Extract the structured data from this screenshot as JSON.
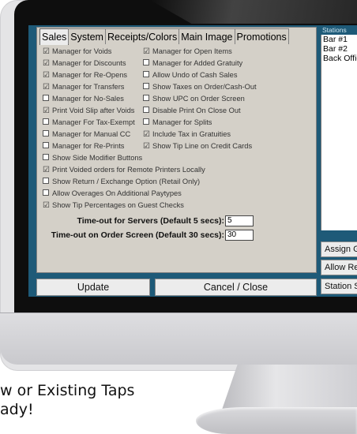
{
  "tabs": [
    "Sales",
    "System",
    "Receipts/Colors",
    "Main Image",
    "Promotions"
  ],
  "options_left": [
    {
      "label": "Manager for Voids",
      "checked": true
    },
    {
      "label": "Manager for Discounts",
      "checked": true
    },
    {
      "label": "Manager for Re-Opens",
      "checked": true
    },
    {
      "label": "Manager for Transfers",
      "checked": true
    },
    {
      "label": "Manager for No-Sales",
      "checked": false
    },
    {
      "label": "Print Void Slip after Voids",
      "checked": true
    },
    {
      "label": "Manager For Tax-Exempt",
      "checked": false
    },
    {
      "label": "Manager for Manual CC",
      "checked": false
    },
    {
      "label": "Manager for Re-Prints",
      "checked": false
    }
  ],
  "options_right": [
    {
      "label": "Manager for Open Items",
      "checked": true
    },
    {
      "label": "Manager for Added Gratuity",
      "checked": false
    },
    {
      "label": "Allow Undo of Cash Sales",
      "checked": false
    },
    {
      "label": "Show Taxes on Order/Cash-Out",
      "checked": false
    },
    {
      "label": "Show UPC on Order Screen",
      "checked": false
    },
    {
      "label": "Disable Print On Close Out",
      "checked": false
    },
    {
      "label": "Manager for Splits",
      "checked": false
    },
    {
      "label": "Include Tax in Gratuities",
      "checked": true
    },
    {
      "label": "Show Tip Line on Credit Cards",
      "checked": true
    }
  ],
  "options_full": [
    {
      "label": "Show Side Modifier Buttons",
      "checked": false
    },
    {
      "label": "Print Voided orders for Remote Printers Locally",
      "checked": true
    },
    {
      "label": "Show Return / Exchange Option (Retail Only)",
      "checked": false
    },
    {
      "label": "Allow Overages On Additional Paytypes",
      "checked": false
    },
    {
      "label": "Show Tip Percentages on Guest Checks",
      "checked": true
    }
  ],
  "timeouts": [
    {
      "label": "Time-out for Servers (Default 5 secs):",
      "value": "5"
    },
    {
      "label": "Time-out on Order Screen (Default 30 secs):",
      "value": "30"
    }
  ],
  "buttons": {
    "update": "Update",
    "cancel": "Cancel / Close"
  },
  "stations": {
    "header": "Stations",
    "items": [
      "Bar #1",
      "Bar #2",
      "Back Office"
    ],
    "assign": "Assign G",
    "allow_remote": "Allow Remot",
    "station_s": "Station S"
  },
  "caption": {
    "line1": "w or Existing Taps",
    "line2": "ady!"
  }
}
